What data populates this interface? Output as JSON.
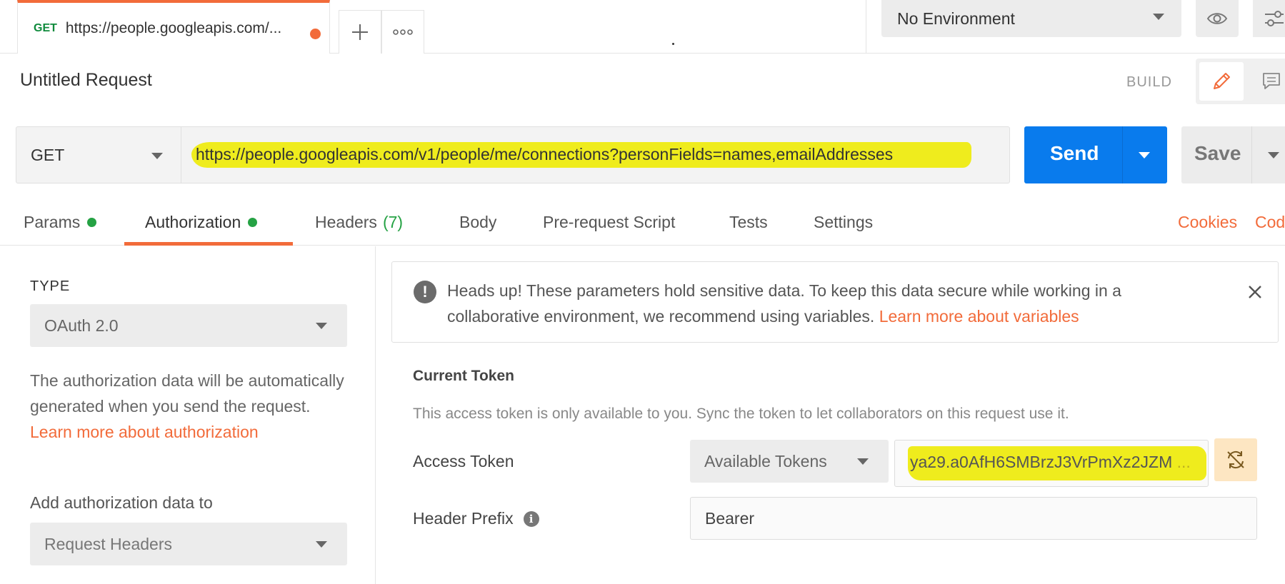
{
  "tab": {
    "method": "GET",
    "url": "https://people.googleapis.com/...",
    "unsaved_color": "#f26b3a"
  },
  "tab_actions": {
    "new_tab_icon": "plus-icon",
    "more_tabs_icon": "ellipsis-icon"
  },
  "environment": {
    "selected": "No Environment",
    "quick_look_icon": "eye-icon",
    "manage_icon": "sliders-icon"
  },
  "request": {
    "title": "Untitled Request",
    "mode_label": "BUILD",
    "method": "GET",
    "url": "https://people.googleapis.com/v1/people/me/connections?personFields=names,emailAddresses",
    "send_label": "Send",
    "save_label": "Save"
  },
  "request_tabs": {
    "params": "Params",
    "authorization": "Authorization",
    "headers": "Headers",
    "headers_count": "(7)",
    "body": "Body",
    "pre_request": "Pre-request Script",
    "tests": "Tests",
    "settings": "Settings",
    "cookies": "Cookies",
    "code": "Cod"
  },
  "auth": {
    "type_label": "TYPE",
    "type_value": "OAuth 2.0",
    "description": "The authorization data will be automatically generated when you send the request.",
    "learn_more": "Learn more about authorization",
    "add_to_label": "Add authorization data to",
    "add_to_value": "Request Headers"
  },
  "notice": {
    "text": "Heads up! These parameters hold sensitive data. To keep this data secure while working in a collaborative environment, we recommend using variables.",
    "link": "Learn more about variables"
  },
  "token": {
    "section_title": "Current Token",
    "description": "This access token is only available to you. Sync the token to let collaborators on this request use it.",
    "access_token_label": "Access Token",
    "available_tokens": "Available Tokens",
    "access_token_value": "ya29.a0AfH6SMBrzJ3VrPmXz2JZM",
    "ellipsis": "...",
    "header_prefix_label": "Header Prefix",
    "header_prefix_value": "Bearer"
  },
  "colors": {
    "accent": "#f26b3a",
    "primary": "#097bed",
    "success": "#25a244",
    "highlight": "#efec1d"
  }
}
